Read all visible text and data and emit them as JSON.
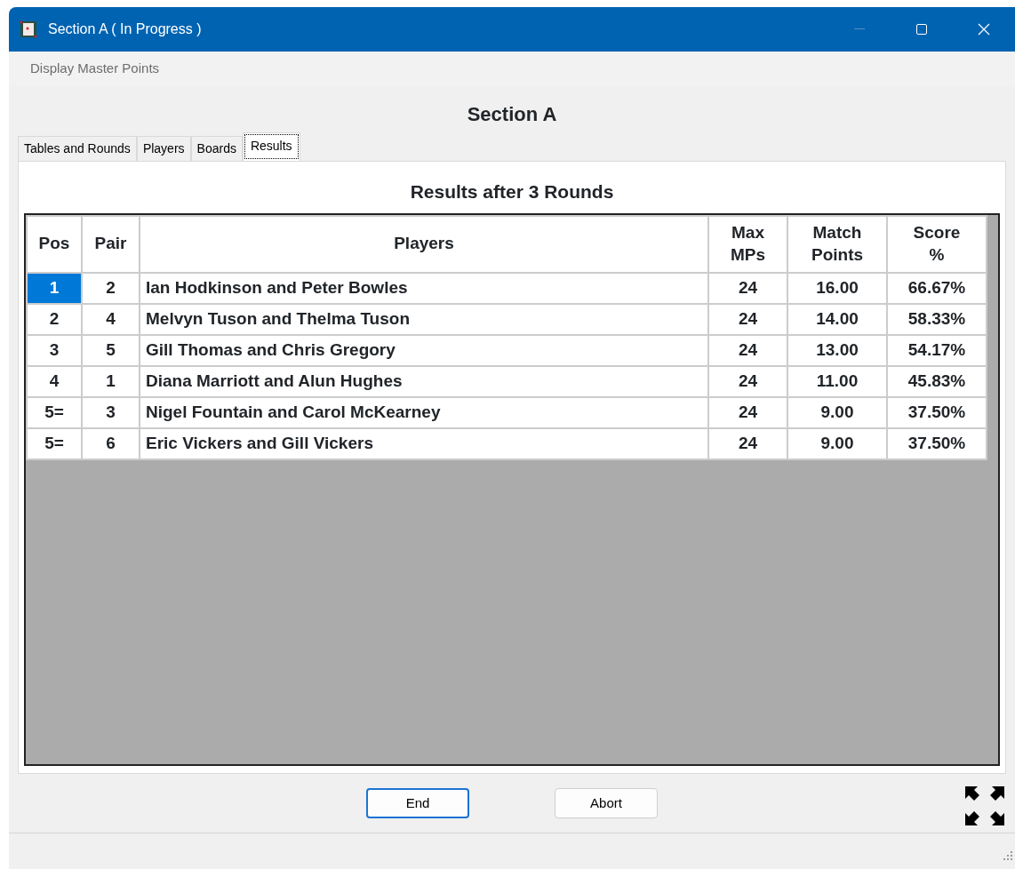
{
  "window": {
    "title": "Section A ( In Progress )"
  },
  "menu": [
    "Display Master Points"
  ],
  "heading": "Section  A",
  "tabs": [
    {
      "label": "Tables and Rounds",
      "selected": false
    },
    {
      "label": "Players",
      "selected": false
    },
    {
      "label": "Boards",
      "selected": false
    },
    {
      "label": "Results",
      "selected": true
    }
  ],
  "results": {
    "title": "Results after 3 Rounds",
    "columns": [
      "Pos",
      "Pair",
      "Players",
      "Max MPs",
      "Match Points",
      "Score %"
    ],
    "rows": [
      {
        "selected": true,
        "cells": [
          "1",
          "2",
          "Ian Hodkinson and Peter Bowles",
          "24",
          "16.00",
          "66.67%"
        ]
      },
      {
        "selected": false,
        "cells": [
          "2",
          "4",
          "Melvyn Tuson and Thelma Tuson",
          "24",
          "14.00",
          "58.33%"
        ]
      },
      {
        "selected": false,
        "cells": [
          "3",
          "5",
          "Gill Thomas and Chris Gregory",
          "24",
          "13.00",
          "54.17%"
        ]
      },
      {
        "selected": false,
        "cells": [
          "4",
          "1",
          "Diana Marriott and Alun Hughes",
          "24",
          "11.00",
          "45.83%"
        ]
      },
      {
        "selected": false,
        "cells": [
          "5=",
          "3",
          "Nigel Fountain and Carol McKearney",
          "24",
          "9.00",
          "37.50%"
        ]
      },
      {
        "selected": false,
        "cells": [
          "5=",
          "6",
          "Eric Vickers and Gill Vickers",
          "24",
          "9.00",
          "37.50%"
        ]
      }
    ]
  },
  "buttons": [
    {
      "label": "End",
      "default": true
    },
    {
      "label": "Abort",
      "default": false
    }
  ]
}
